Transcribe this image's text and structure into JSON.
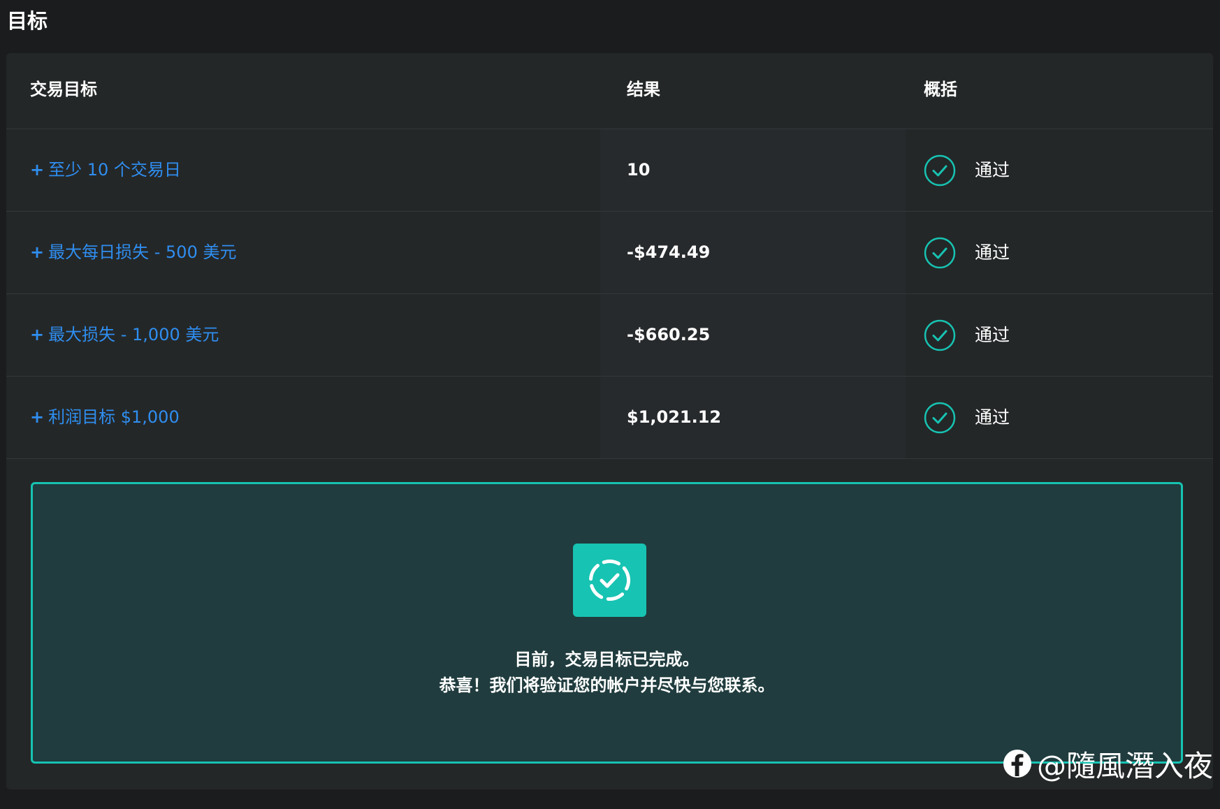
{
  "page": {
    "title": "目标"
  },
  "table": {
    "headers": {
      "goal": "交易目标",
      "result": "结果",
      "summary": "概括"
    },
    "rows": [
      {
        "goal": "至少 10 个交易日",
        "result": "10",
        "status": "通过"
      },
      {
        "goal": "最大每日损失 - 500 美元",
        "result": "-$474.49",
        "status": "通过"
      },
      {
        "goal": "最大损失 - 1,000 美元",
        "result": "-$660.25",
        "status": "通过"
      },
      {
        "goal": "利润目标 $1,000",
        "result": "$1,021.12",
        "status": "通过"
      }
    ],
    "expand_symbol": "+"
  },
  "success": {
    "line1": "目前，交易目标已完成。",
    "line2": "恭喜！我们将验证您的帐户并尽快与您联系。",
    "icon": "dashed-circle-check-icon"
  },
  "watermark": {
    "text": "@隨風潛入夜",
    "icon": "facebook-icon"
  },
  "colors": {
    "background": "#1b1c1d",
    "panel": "#242728",
    "link": "#2f8ef0",
    "accent": "#17c3b2",
    "success_bg": "#203c3e"
  }
}
